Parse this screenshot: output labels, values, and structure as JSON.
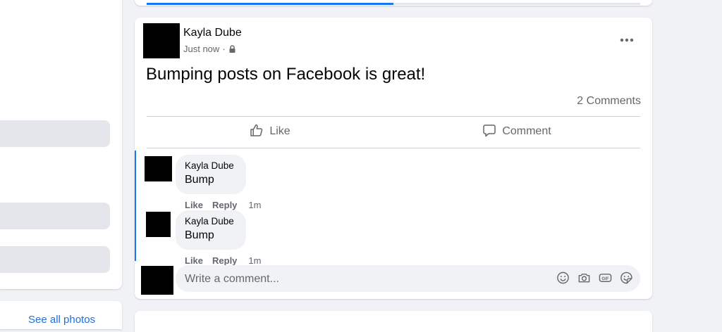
{
  "post": {
    "author": "Kayla Dube",
    "time": "Just now",
    "separator": "·",
    "text": "Bumping posts on Facebook is great!",
    "comments_count": "2 Comments"
  },
  "actions": {
    "like": "Like",
    "comment": "Comment"
  },
  "comments": [
    {
      "author": "Kayla Dube",
      "text": "Bump",
      "like": "Like",
      "reply": "Reply",
      "time": "1m"
    },
    {
      "author": "Kayla Dube",
      "text": "Bump",
      "like": "Like",
      "reply": "Reply",
      "time": "1m"
    }
  ],
  "composer": {
    "placeholder": "Write a comment...",
    "icons": [
      "emoji-icon",
      "camera-icon",
      "gif-icon",
      "sticker-icon"
    ]
  },
  "progress": {
    "percent": 50
  },
  "sidebar": {
    "link_text": "See all photos"
  },
  "colors": {
    "accent": "#1877f2",
    "secondary_text": "#65676b",
    "background": "#f0f2f5"
  }
}
